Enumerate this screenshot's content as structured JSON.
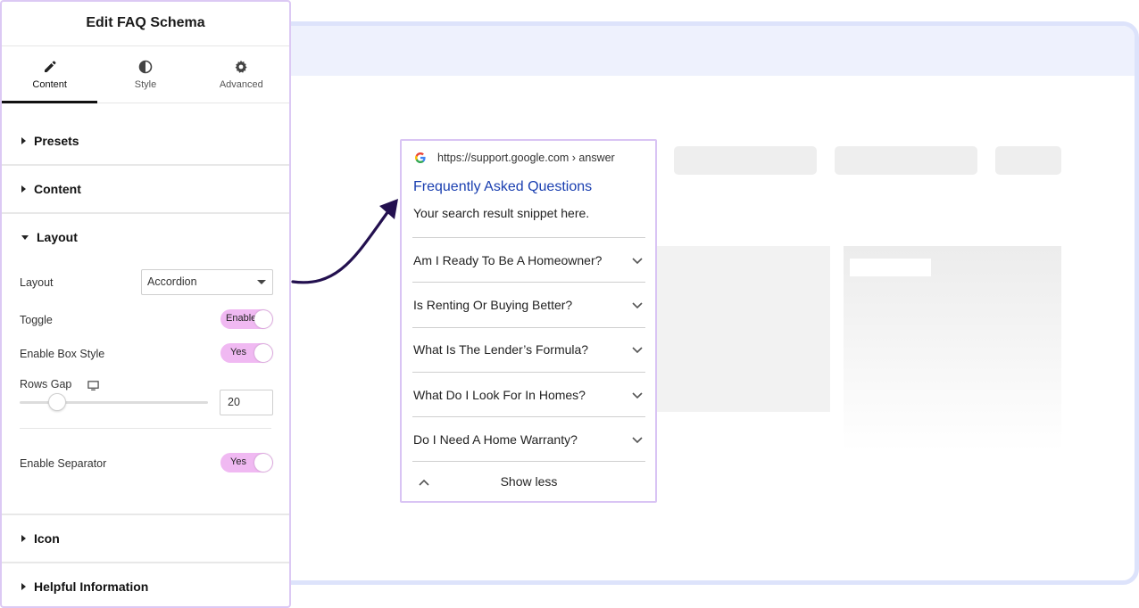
{
  "panel": {
    "title": "Edit FAQ Schema",
    "tabs": [
      {
        "label": "Content",
        "icon": "pencil-icon",
        "active": true
      },
      {
        "label": "Style",
        "icon": "contrast-icon",
        "active": false
      },
      {
        "label": "Advanced",
        "icon": "gear-icon",
        "active": false
      }
    ],
    "sections": {
      "presets": "Presets",
      "content": "Content",
      "layout": "Layout",
      "icon": "Icon",
      "helpful": "Helpful Information"
    },
    "layout": {
      "layout_label": "Layout",
      "layout_value": "Accordion",
      "toggle_label": "Toggle",
      "toggle_value": "Enable",
      "box_style_label": "Enable Box Style",
      "box_style_value": "Yes",
      "rows_gap_label": "Rows Gap",
      "rows_gap_value": "20",
      "separator_label": "Enable Separator",
      "separator_value": "Yes"
    }
  },
  "result": {
    "url": "https://support.google.com › answer",
    "title": "Frequently Asked Questions",
    "snippet": "Your search result snippet here.",
    "questions": [
      "Am I Ready To Be A Homeowner?",
      "Is Renting Or Buying Better?",
      "What Is The Lender’s Formula?",
      "What Do I Look For In Homes?",
      "Do I Need A Home Warranty?"
    ],
    "show_less": "Show less"
  },
  "colors": {
    "accent_toggle": "#f0b9f2",
    "card_border": "#d9c4f4",
    "link_blue": "#1a3fb0",
    "arrow": "#23104f"
  }
}
